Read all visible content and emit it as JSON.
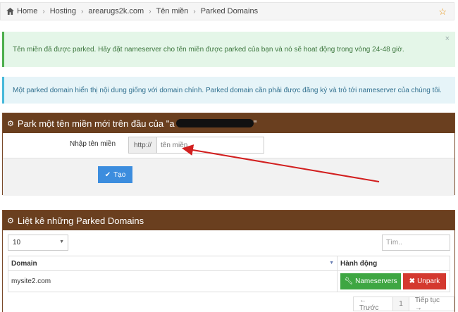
{
  "breadcrumb": {
    "items": [
      "Home",
      "Hosting",
      "arearugs2k.com",
      "Tên miền",
      "Parked Domains"
    ]
  },
  "alerts": {
    "success": "Tên miền đã được parked. Hãy đặt nameserver cho tên miền được parked của bạn và nó sẽ hoat động trong vòng 24-48 giờ.",
    "info": "Một parked domain hiển thị nội dung giống với domain chính. Parked domain cần phải được đăng ký và trỏ tới nameserver của chúng tôi."
  },
  "park_panel": {
    "title": "Park một tên miền mới trên đầu của \"a",
    "title_end": "\"",
    "label": "Nhập tên miền",
    "prefix": "http://",
    "placeholder": "tên miền",
    "submit_label": "Tạo"
  },
  "list_panel": {
    "title": "Liệt kê những Parked Domains",
    "page_size": "10",
    "search_placeholder": "Tìm..",
    "columns": [
      "Domain",
      "Hành động"
    ],
    "rows": [
      {
        "domain": "mysite2.com",
        "ns_label": "Nameservers",
        "unpark_label": "Unpark"
      }
    ],
    "pager": {
      "prev": "← Trước",
      "page": "1",
      "next": "Tiếp tục →"
    }
  },
  "colors": {
    "panel_header": "#6a3f1f",
    "success_bg": "#e4f6e8",
    "info_bg": "#e6f4f8",
    "primary": "#3c8dde",
    "green": "#3ea642",
    "red": "#d4392f",
    "annotation_arrow": "#d21f1f"
  }
}
